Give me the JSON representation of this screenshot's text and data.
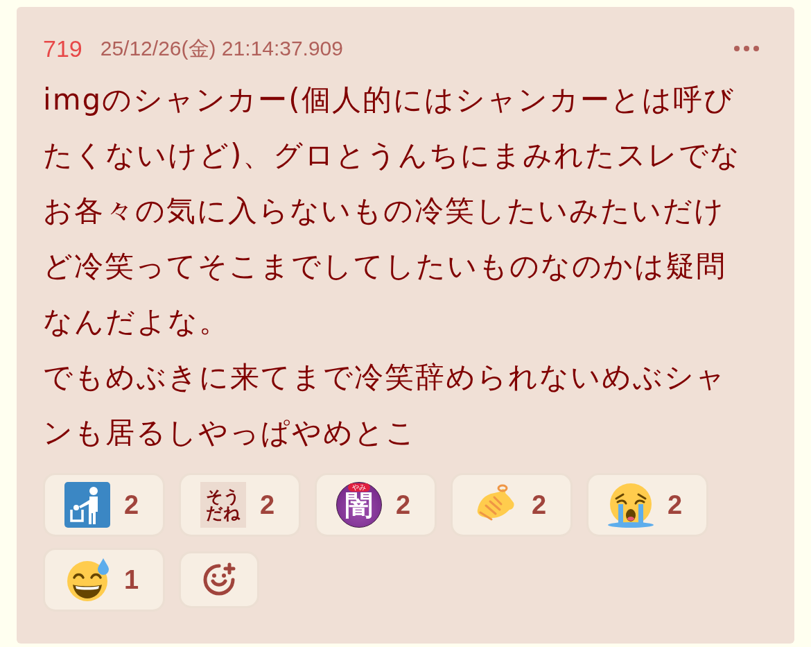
{
  "post": {
    "number": "719",
    "date": "25/12/26(金) 21:14:37.909",
    "body": [
      "imgのシャンカー(個人的にはシャンカーとは呼びたくないけど)、グロとうんちにまみれたスレでなお各々の気に入らないもの冷笑したいみたいだけど冷笑ってそこまでしてしたいものなのかは疑問なんだよな。",
      "でもめぶきに来てまで冷笑辞められないめぶシャンも居るしやっぱやめとこ"
    ],
    "reactions": [
      {
        "kind": "trash",
        "count": "2"
      },
      {
        "kind": "label",
        "label": [
          "そう",
          "だね"
        ],
        "count": "2"
      },
      {
        "kind": "badge",
        "label": "闇",
        "ruby": "やみ",
        "count": "2"
      },
      {
        "kind": "pointing",
        "count": "2"
      },
      {
        "kind": "crying",
        "count": "2"
      },
      {
        "kind": "sweat",
        "count": "1"
      }
    ]
  }
}
